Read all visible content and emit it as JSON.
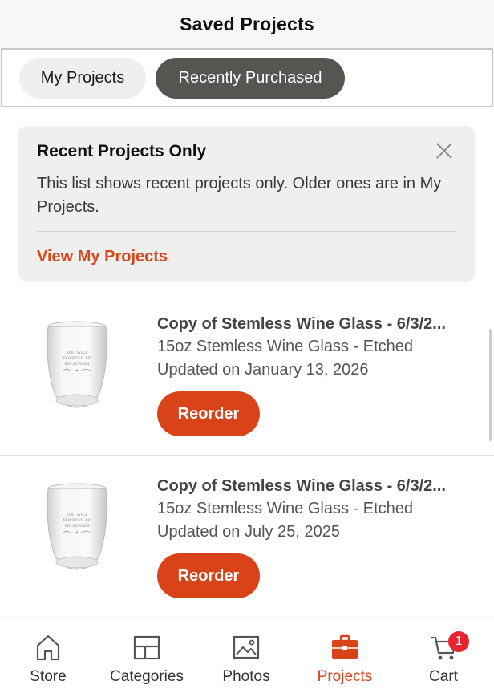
{
  "header": {
    "title": "Saved Projects"
  },
  "tabs": [
    {
      "label": "My Projects",
      "active": false
    },
    {
      "label": "Recently Purchased",
      "active": true
    }
  ],
  "notice": {
    "title": "Recent Projects Only",
    "body": "This list shows recent projects only. Older ones are in My Projects.",
    "link": "View My Projects",
    "close_icon": "close-icon"
  },
  "projects": [
    {
      "title": "Copy of Stemless Wine Glass - 6/3/2...",
      "product": "15oz Stemless Wine Glass - Etched",
      "updated": "Updated on January 13, 2026",
      "action": "Reorder",
      "engraving": [
        "YOU WILL",
        "FOREVER BE",
        "MY ALWAYS"
      ]
    },
    {
      "title": "Copy of Stemless Wine Glass - 6/3/2...",
      "product": "15oz Stemless Wine Glass - Etched",
      "updated": "Updated on July 25, 2025",
      "action": "Reorder",
      "engraving": [
        "YOU WILL",
        "FOREVER BE",
        "MY ALWAYS"
      ]
    }
  ],
  "tabbar": {
    "items": [
      {
        "label": "Store",
        "icon": "home-icon"
      },
      {
        "label": "Categories",
        "icon": "categories-icon"
      },
      {
        "label": "Photos",
        "icon": "photos-icon"
      },
      {
        "label": "Projects",
        "icon": "briefcase-icon",
        "active": true
      },
      {
        "label": "Cart",
        "icon": "cart-icon",
        "badge": "1"
      }
    ]
  },
  "colors": {
    "accent": "#d8431a",
    "active_tab": "#555651",
    "badge": "#e8242f"
  }
}
